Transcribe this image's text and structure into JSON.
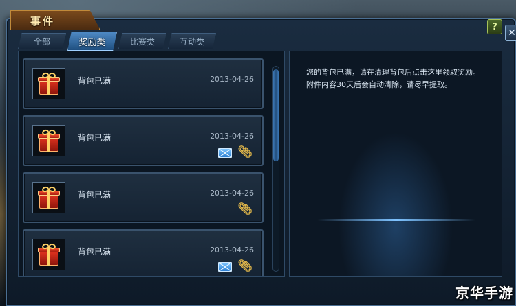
{
  "window": {
    "title": "事件",
    "help_label": "?",
    "close_label": "✕"
  },
  "tabs": [
    {
      "label": "全部",
      "active": false
    },
    {
      "label": "奖励类",
      "active": true
    },
    {
      "label": "比赛类",
      "active": false
    },
    {
      "label": "互动类",
      "active": false
    }
  ],
  "mail_list": [
    {
      "subject": "背包已满",
      "date": "2013-04-26",
      "icon": "gift-box-icon",
      "envelope": false,
      "attachment": false
    },
    {
      "subject": "背包已满",
      "date": "2013-04-26",
      "icon": "gift-box-icon",
      "envelope": true,
      "attachment": true
    },
    {
      "subject": "背包已满",
      "date": "2013-04-26",
      "icon": "gift-box-icon",
      "envelope": false,
      "attachment": true
    },
    {
      "subject": "背包已满",
      "date": "2013-04-26",
      "icon": "gift-box-icon",
      "envelope": true,
      "attachment": true
    }
  ],
  "detail": {
    "body": "您的背包已满，请在清理背包后点击这里领取奖励。附件内容30天后会自动清除，请尽早提取。"
  },
  "watermark": "京华手游",
  "colors": {
    "accent": "#4e89c4",
    "title_tab": "#7a4a1c",
    "gift_red": "#e2331f",
    "clip_gold": "#e0b64a"
  }
}
